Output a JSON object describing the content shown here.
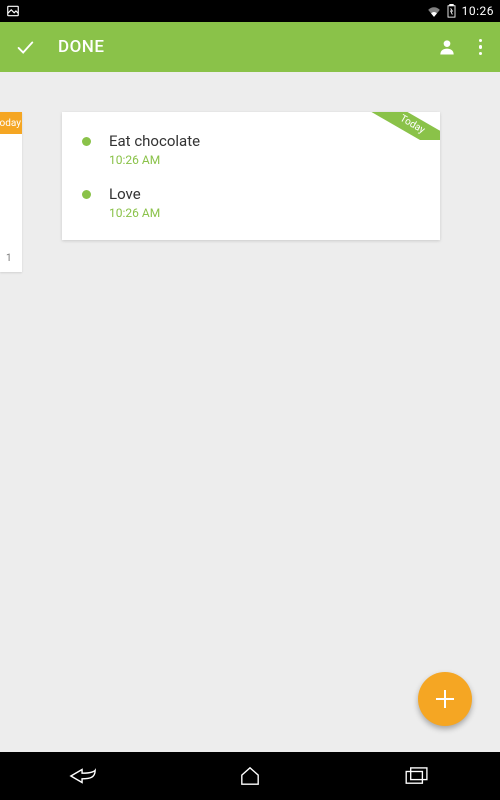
{
  "status": {
    "time": "10:26"
  },
  "colors": {
    "accent": "#8ac249",
    "fab": "#f5a623"
  },
  "appbar": {
    "title": "DONE"
  },
  "side": {
    "tag": "oday",
    "num": "1"
  },
  "card": {
    "ribbon": "Today",
    "tasks": [
      {
        "title": "Eat chocolate",
        "time": "10:26 AM"
      },
      {
        "title": "Love",
        "time": "10:26 AM"
      }
    ]
  }
}
